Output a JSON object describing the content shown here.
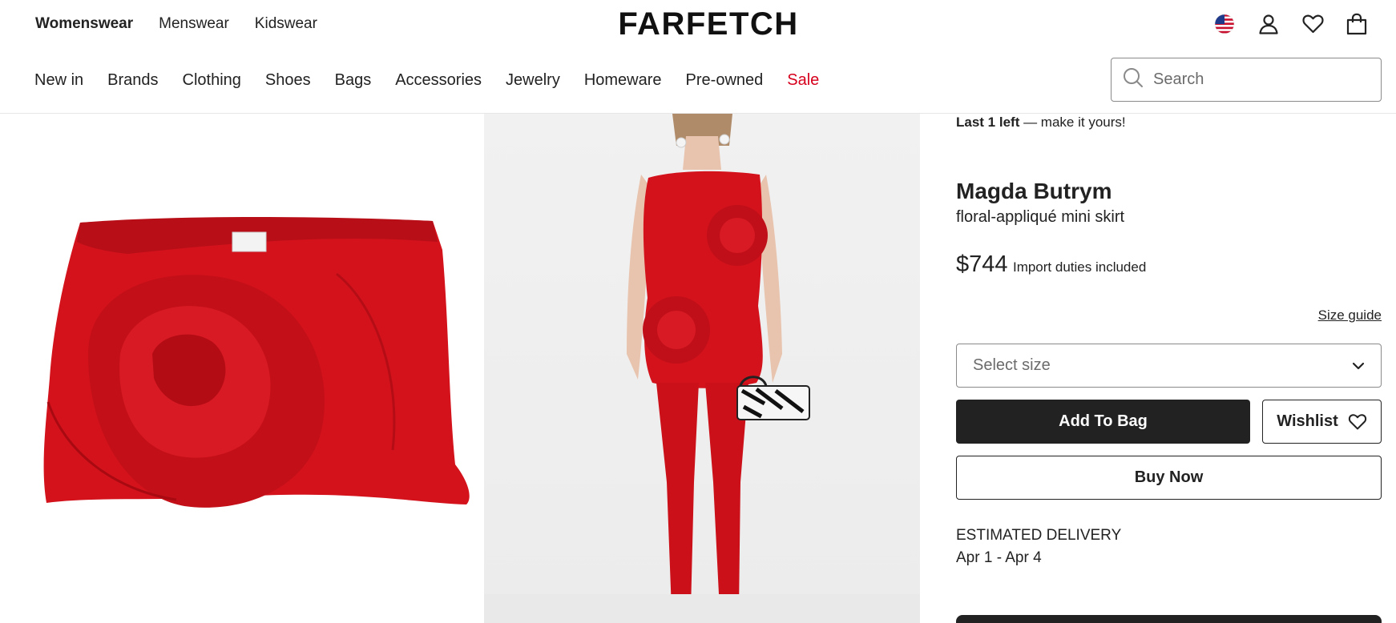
{
  "header": {
    "gender_nav": [
      {
        "label": "Womenswear",
        "active": true
      },
      {
        "label": "Menswear",
        "active": false
      },
      {
        "label": "Kidswear",
        "active": false
      }
    ],
    "logo": "FARFETCH",
    "utility_icons": [
      "us-flag-icon",
      "account-icon",
      "wishlist-heart-icon",
      "bag-icon"
    ],
    "categories": [
      "New in",
      "Brands",
      "Clothing",
      "Shoes",
      "Bags",
      "Accessories",
      "Jewelry",
      "Homeware",
      "Pre-owned",
      "Sale"
    ],
    "search": {
      "placeholder": "Search"
    }
  },
  "product": {
    "stock_bold": "Last 1 left",
    "stock_note": " — make it yours!",
    "brand": "Magda Butrym",
    "name": "floral-appliqué mini skirt",
    "price": "$744",
    "duties": "Import duties included",
    "size_guide": "Size guide",
    "size_placeholder": "Select size",
    "add_to_bag": "Add To Bag",
    "wishlist": "Wishlist",
    "buy_now": "Buy Now",
    "delivery_label": "ESTIMATED DELIVERY",
    "delivery_dates": "Apr 1 - Apr 4"
  },
  "colors": {
    "accent_dark": "#222222",
    "sale_red": "#d6001c",
    "product_red": "#d3121c"
  }
}
